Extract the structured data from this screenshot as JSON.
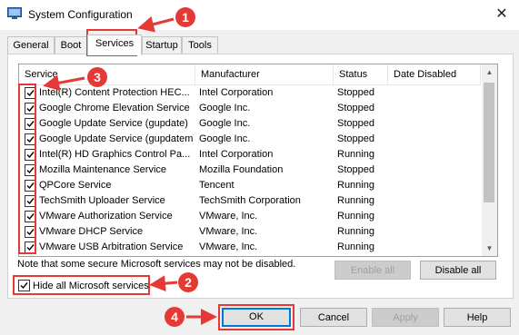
{
  "window": {
    "title": "System Configuration",
    "close_glyph": "✕"
  },
  "tabs": [
    {
      "label": "General"
    },
    {
      "label": "Boot"
    },
    {
      "label": "Services"
    },
    {
      "label": "Startup"
    },
    {
      "label": "Tools"
    }
  ],
  "list": {
    "columns": [
      "Service",
      "Manufacturer",
      "Status",
      "Date Disabled"
    ],
    "rows": [
      {
        "service": "Intel(R) Content Protection HEC...",
        "manufacturer": "Intel Corporation",
        "status": "Stopped",
        "checked": true
      },
      {
        "service": "Google Chrome Elevation Service",
        "manufacturer": "Google Inc.",
        "status": "Stopped",
        "checked": true
      },
      {
        "service": "Google Update Service (gupdate)",
        "manufacturer": "Google Inc.",
        "status": "Stopped",
        "checked": true
      },
      {
        "service": "Google Update Service (gupdatem)",
        "manufacturer": "Google Inc.",
        "status": "Stopped",
        "checked": true
      },
      {
        "service": "Intel(R) HD Graphics Control Pa...",
        "manufacturer": "Intel Corporation",
        "status": "Running",
        "checked": true
      },
      {
        "service": "Mozilla Maintenance Service",
        "manufacturer": "Mozilla Foundation",
        "status": "Stopped",
        "checked": true
      },
      {
        "service": "QPCore Service",
        "manufacturer": "Tencent",
        "status": "Running",
        "checked": true
      },
      {
        "service": "TechSmith Uploader Service",
        "manufacturer": "TechSmith Corporation",
        "status": "Running",
        "checked": true
      },
      {
        "service": "VMware Authorization Service",
        "manufacturer": "VMware, Inc.",
        "status": "Running",
        "checked": true
      },
      {
        "service": "VMware DHCP Service",
        "manufacturer": "VMware, Inc.",
        "status": "Running",
        "checked": true
      },
      {
        "service": "VMware USB Arbitration Service",
        "manufacturer": "VMware, Inc.",
        "status": "Running",
        "checked": true
      }
    ]
  },
  "note": "Note that some secure Microsoft services may not be disabled.",
  "buttons": {
    "enable_all": "Enable all",
    "disable_all": "Disable all",
    "ok": "OK",
    "cancel": "Cancel",
    "apply": "Apply",
    "help": "Help"
  },
  "hide_microsoft": {
    "label": "Hide all Microsoft services",
    "checked": true
  },
  "annotations": {
    "step1": "1",
    "step2": "2",
    "step3": "3",
    "step4": "4",
    "color": "#e53935"
  }
}
